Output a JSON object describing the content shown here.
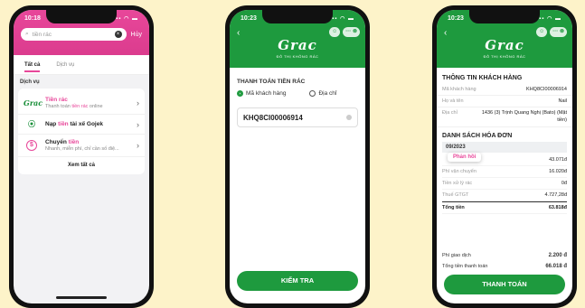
{
  "phone1": {
    "time": "10:18",
    "search_placeholder": "tiền rác",
    "search_action": "Hủy",
    "tabs": [
      {
        "label": "Tất cả"
      },
      {
        "label": "Dịch vụ"
      }
    ],
    "section_label": "Dịch vụ",
    "services": [
      {
        "icon": "grac-logo-icon",
        "glyph": "Grac",
        "title_pre": "",
        "title_hl": "Tiền rác",
        "title_post": "",
        "sub_pre": "Thanh toán ",
        "sub_hl": "tiền rác",
        "sub_post": " online"
      },
      {
        "icon": "gojek-icon",
        "glyph": "⦿",
        "title_pre": "Nạp ",
        "title_hl": "tiền",
        "title_post": " tài xế Gojek",
        "sub_pre": "",
        "sub_hl": "",
        "sub_post": ""
      },
      {
        "icon": "money-transfer-icon",
        "glyph": "$",
        "title_pre": "Chuyển ",
        "title_hl": "tiền",
        "title_post": "",
        "sub_pre": "Nhanh, miễn phí, chỉ cần số điệ...",
        "sub_hl": "",
        "sub_post": ""
      }
    ],
    "see_all": "Xem tất cả"
  },
  "phone2": {
    "time": "10:23",
    "logo": "Grac",
    "logo_sub": "ĐÔ THỊ KHÔNG RÁC",
    "section_title": "THANH TOÁN TIỀN RÁC",
    "radio_customer": "Mã khách hàng",
    "radio_address": "Địa chỉ",
    "customer_code": "KHQ8CI00006914",
    "check_button": "KIỂM TRA"
  },
  "phone3": {
    "time": "10:23",
    "logo": "Grac",
    "logo_sub": "ĐÔ THỊ KHÔNG RÁC",
    "info_title": "THÔNG TIN KHÁCH HÀNG",
    "customer": [
      {
        "k": "Mã khách hàng",
        "v": "KHQ8CI00006914"
      },
      {
        "k": "Họ và tên",
        "v": "Nail"
      },
      {
        "k": "Địa chỉ",
        "v": "1436 (3) Trịnh Quang Nghị (Bato) (Mặt tiền)"
      }
    ],
    "list_title": "DANH SÁCH HÓA ĐƠN",
    "month": "09/2023",
    "feedback": "Phản hồi",
    "bill": [
      {
        "k": "",
        "v": "43.071đ"
      },
      {
        "k": "Phí vận chuyển",
        "v": "16.020đ"
      },
      {
        "k": "Tiền xử lý rác",
        "v": "0đ"
      },
      {
        "k": "Thuế GTGT",
        "v": "4.727,28đ"
      }
    ],
    "total_label": "Tổng tiền",
    "total_value": "63.818đ",
    "fee_label": "Phí giao dịch",
    "fee_value": "2.200 đ",
    "grand_label": "Tổng tiền thanh toán",
    "grand_value": "66.018 đ",
    "pay_button": "THANH TOÁN"
  }
}
